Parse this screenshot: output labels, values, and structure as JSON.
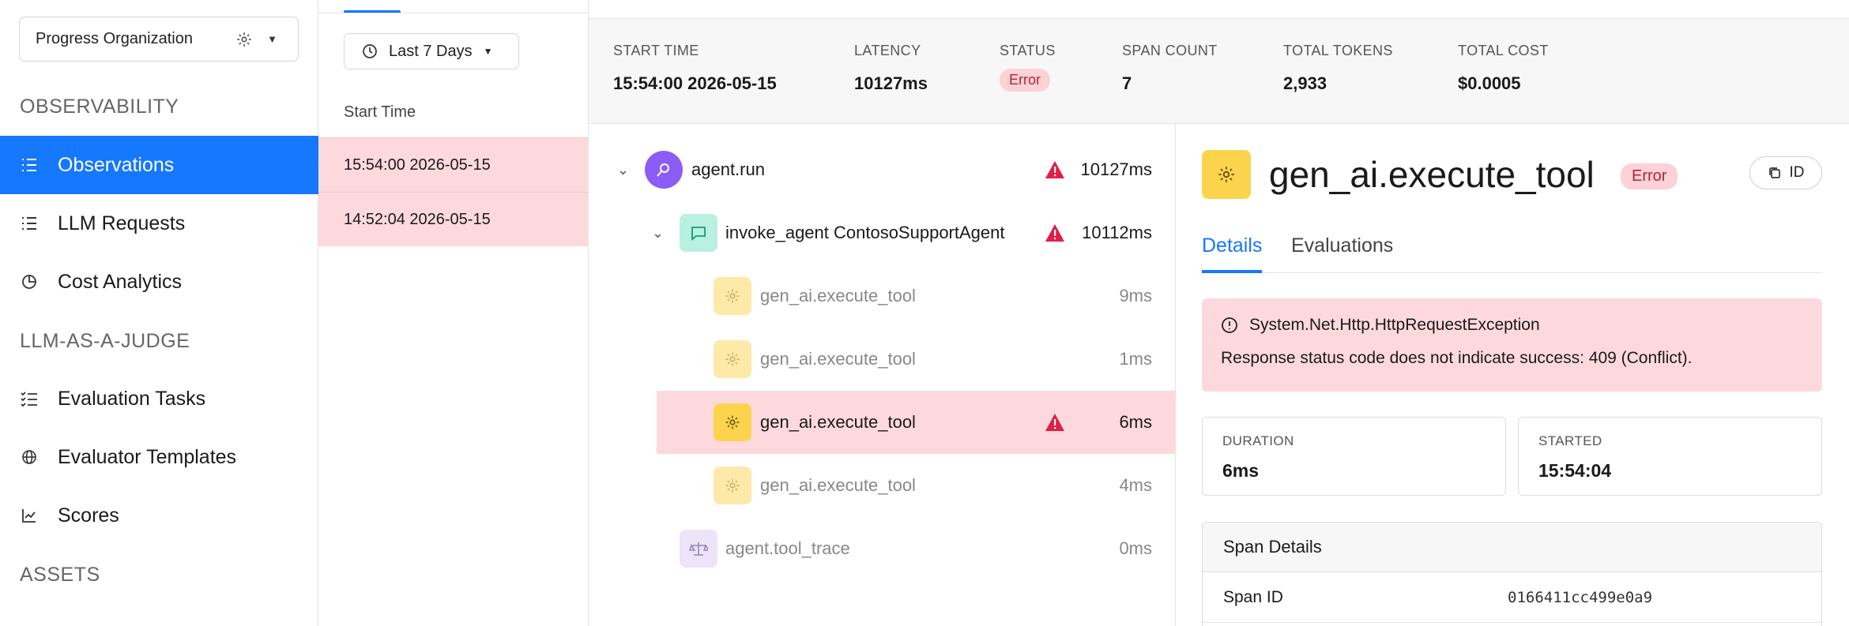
{
  "sidebar": {
    "org_select": "Progress Organization",
    "sections": [
      {
        "title": "OBSERVABILITY"
      },
      {
        "title": "LLM-AS-A-JUDGE"
      },
      {
        "title": "ASSETS"
      }
    ],
    "items": [
      {
        "label": "Observations",
        "icon": "list-icon",
        "active": true
      },
      {
        "label": "LLM Requests",
        "icon": "list-icon"
      },
      {
        "label": "Cost Analytics",
        "icon": "pie-chart-icon"
      },
      {
        "label": "Evaluation Tasks",
        "icon": "checklist-icon"
      },
      {
        "label": "Evaluator Templates",
        "icon": "globe-icon"
      },
      {
        "label": "Scores",
        "icon": "line-chart-icon"
      }
    ]
  },
  "list": {
    "range": "Last 7 Days",
    "column_header": "Start Time",
    "rows": [
      "15:54:00 2026-05-15",
      "14:52:04 2026-05-15"
    ]
  },
  "summary": {
    "start_time_label": "START TIME",
    "start_time": "15:54:00 2026-05-15",
    "latency_label": "LATENCY",
    "latency": "10127ms",
    "status_label": "STATUS",
    "status": "Error",
    "span_count_label": "SPAN COUNT",
    "span_count": "7",
    "total_tokens_label": "TOTAL TOKENS",
    "total_tokens": "2,933",
    "total_cost_label": "TOTAL COST",
    "total_cost": "$0.0005"
  },
  "tree": [
    {
      "name": "agent.run",
      "duration": "10127ms",
      "error": true
    },
    {
      "name": "invoke_agent ContosoSupportAgent",
      "duration": "10112ms",
      "error": true
    },
    {
      "name": "gen_ai.execute_tool",
      "duration": "9ms"
    },
    {
      "name": "gen_ai.execute_tool",
      "duration": "1ms"
    },
    {
      "name": "gen_ai.execute_tool",
      "duration": "6ms",
      "error": true,
      "selected": true
    },
    {
      "name": "gen_ai.execute_tool",
      "duration": "4ms"
    },
    {
      "name": "agent.tool_trace",
      "duration": "0ms"
    }
  ],
  "detail": {
    "title": "gen_ai.execute_tool",
    "status": "Error",
    "id_button": "ID",
    "tabs": [
      "Details",
      "Evaluations"
    ],
    "error_title": "System.Net.Http.HttpRequestException",
    "error_message": "Response status code does not indicate success: 409 (Conflict).",
    "duration_label": "DURATION",
    "duration": "6ms",
    "started_label": "STARTED",
    "started": "15:54:04",
    "span_details_title": "Span Details",
    "span_id_label": "Span ID",
    "span_id": "0166411cc499e0a9"
  },
  "colors": {
    "accent": "#1677ff",
    "error_bg": "#fdd9de",
    "warn": "#e11d48",
    "tool": "#fcd34d"
  }
}
